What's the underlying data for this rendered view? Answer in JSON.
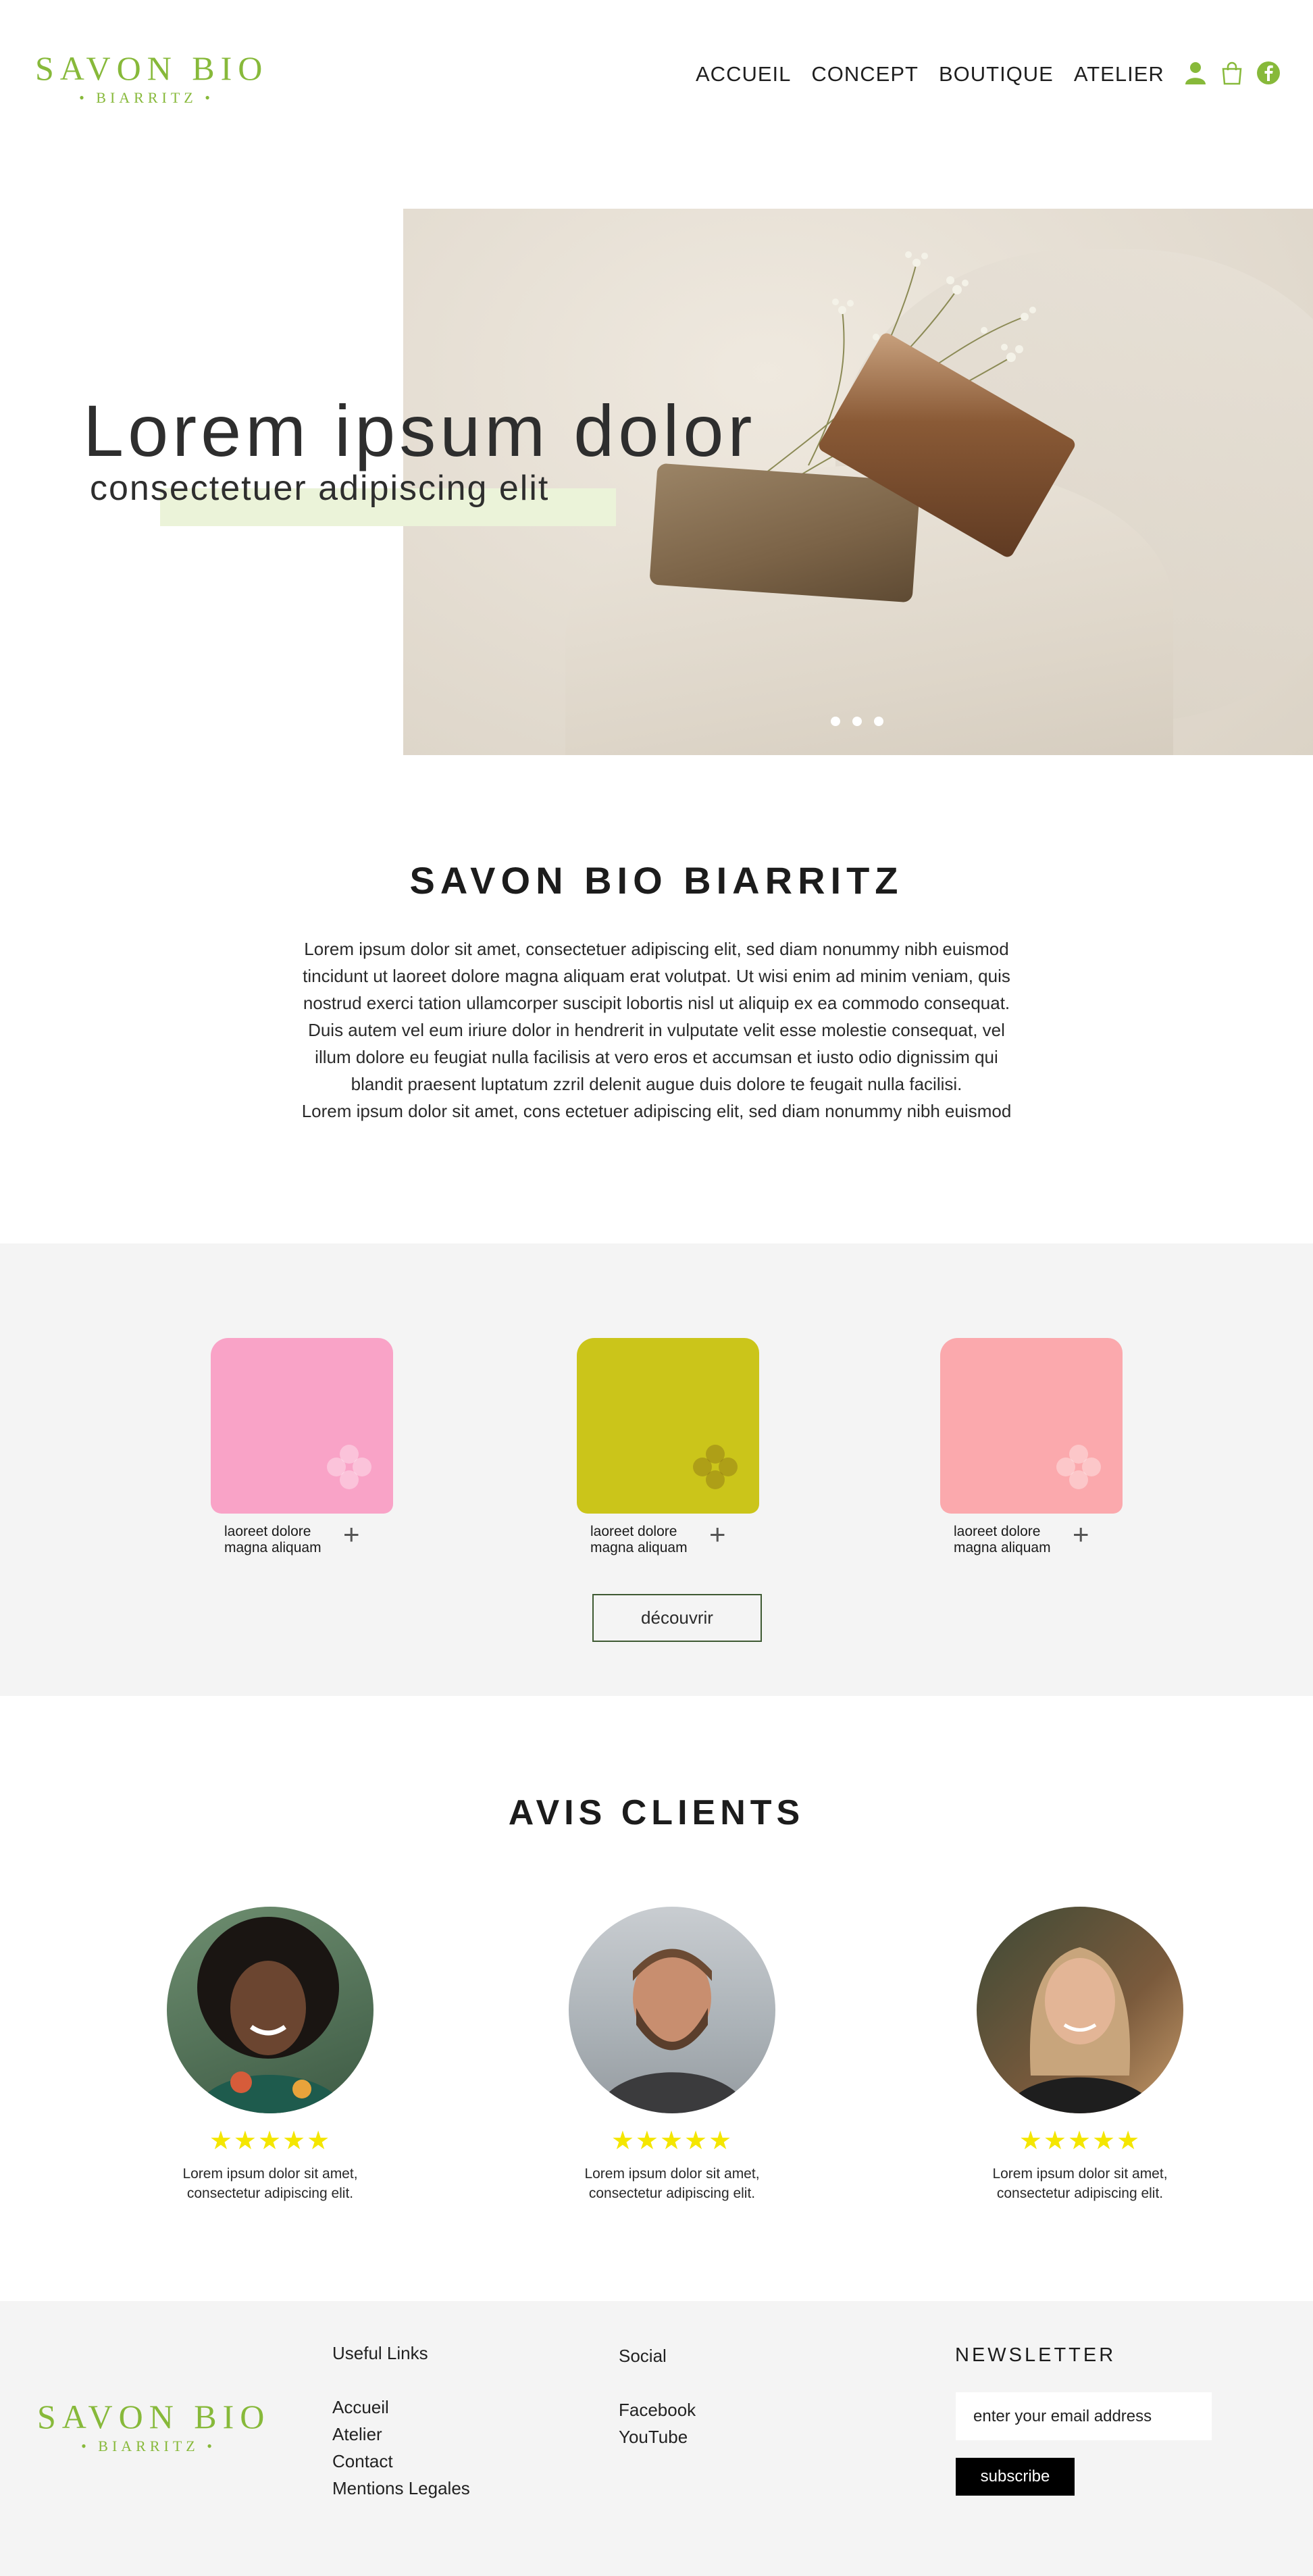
{
  "brand": {
    "line1": "SAVON BIO",
    "line2": "• BIARRITZ •",
    "accent_color": "#87b93a"
  },
  "nav": {
    "items": [
      "ACCUEIL",
      "CONCEPT",
      "BOUTIQUE",
      "ATELIER"
    ]
  },
  "header_icons": [
    "user-icon",
    "shopping-bag-icon",
    "facebook-icon"
  ],
  "hero": {
    "title": "Lorem ipsum dolor",
    "subtitle": "consectetuer adipiscing elit",
    "slides": 3,
    "highlight_color": "#ebf3d9"
  },
  "intro": {
    "title": "SAVON BIO BIARRITZ",
    "lines": [
      "Lorem ipsum dolor sit amet, consectetuer adipiscing elit, sed diam nonummy nibh euismod",
      "tincidunt ut laoreet dolore magna aliquam erat volutpat. Ut wisi enim ad minim veniam, quis",
      "nostrud exerci tation ullamcorper suscipit lobortis nisl ut aliquip ex ea commodo consequat.",
      "Duis autem vel eum iriure dolor in hendrerit in vulputate velit esse molestie consequat, vel",
      "illum dolore eu feugiat nulla facilisis at vero eros et accumsan et iusto odio dignissim qui",
      "blandit praesent luptatum zzril delenit augue duis dolore te feugait nulla facilisi.",
      "Lorem ipsum dolor sit amet, cons ectetuer adipiscing elit, sed diam nonummy nibh euismod"
    ]
  },
  "products": {
    "items": [
      {
        "line1": "laoreet dolore",
        "line2": "magna aliquam",
        "color": "#f9a3c7"
      },
      {
        "line1": "laoreet dolore",
        "line2": "magna aliquam",
        "color": "#cbc51a"
      },
      {
        "line1": "laoreet dolore",
        "line2": "magna aliquam",
        "color": "#fba9ad"
      }
    ],
    "plus": "+",
    "discover_label": "découvrir"
  },
  "reviews": {
    "title": "AVIS CLIENTS",
    "items": [
      {
        "stars": "★★★★★",
        "line1": "Lorem ipsum dolor sit amet,",
        "line2": "consectetur adipiscing elit."
      },
      {
        "stars": "★★★★★",
        "line1": "Lorem ipsum dolor sit amet,",
        "line2": "consectetur adipiscing elit."
      },
      {
        "stars": "★★★★★",
        "line1": "Lorem ipsum dolor sit amet,",
        "line2": "consectetur adipiscing elit."
      }
    ],
    "rating": 5,
    "star_color": "#f4e600"
  },
  "footer": {
    "useful_links": {
      "title": "Useful Links",
      "links": [
        "Accueil",
        "Atelier",
        "Contact",
        "Mentions Legales"
      ]
    },
    "social": {
      "title": "Social",
      "links": [
        "Facebook",
        "YouTube"
      ]
    },
    "newsletter": {
      "title": "NEWSLETTER",
      "placeholder": "enter your email address",
      "button": "subscribe"
    }
  }
}
